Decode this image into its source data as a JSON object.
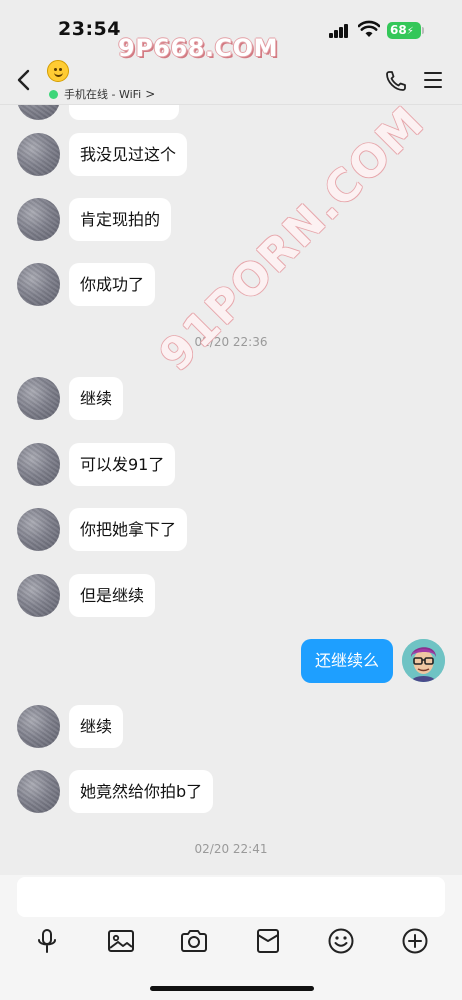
{
  "status_bar": {
    "time": "23:54",
    "battery": "68",
    "watermark": "9P668.COM"
  },
  "watermark_diagonal": "91PORN.COM",
  "header": {
    "contact_emoji": "upside-down-face",
    "online_status": "手机在线 - WiFi",
    "online_chevron": ">",
    "icons": [
      "back-arrow-icon",
      "phone-icon",
      "menu-icon"
    ]
  },
  "messages": [
    {
      "side": "left",
      "text": "我没见过这个"
    },
    {
      "side": "left",
      "text": "肯定现拍的"
    },
    {
      "side": "left",
      "text": "你成功了"
    },
    {
      "type": "timestamp",
      "text": "02/20 22:36"
    },
    {
      "side": "left",
      "text": "继续"
    },
    {
      "side": "left",
      "text": "可以发91了"
    },
    {
      "side": "left",
      "text": "你把她拿下了"
    },
    {
      "side": "left",
      "text": "但是继续"
    },
    {
      "side": "right",
      "text": "还继续么"
    },
    {
      "side": "left",
      "text": "继续"
    },
    {
      "side": "left",
      "text": "她竟然给你拍b了"
    },
    {
      "type": "timestamp",
      "text": "02/20 22:41"
    }
  ],
  "composer": {
    "input_value": "",
    "tools": [
      "microphone-icon",
      "image-icon",
      "camera-icon",
      "red-packet-icon",
      "emoji-icon",
      "plus-icon"
    ]
  },
  "colors": {
    "background": "#ededed",
    "incoming_bubble": "#ffffff",
    "outgoing_bubble": "#1e9fff",
    "online_dot": "#3ed67a",
    "battery": "#34c759"
  }
}
